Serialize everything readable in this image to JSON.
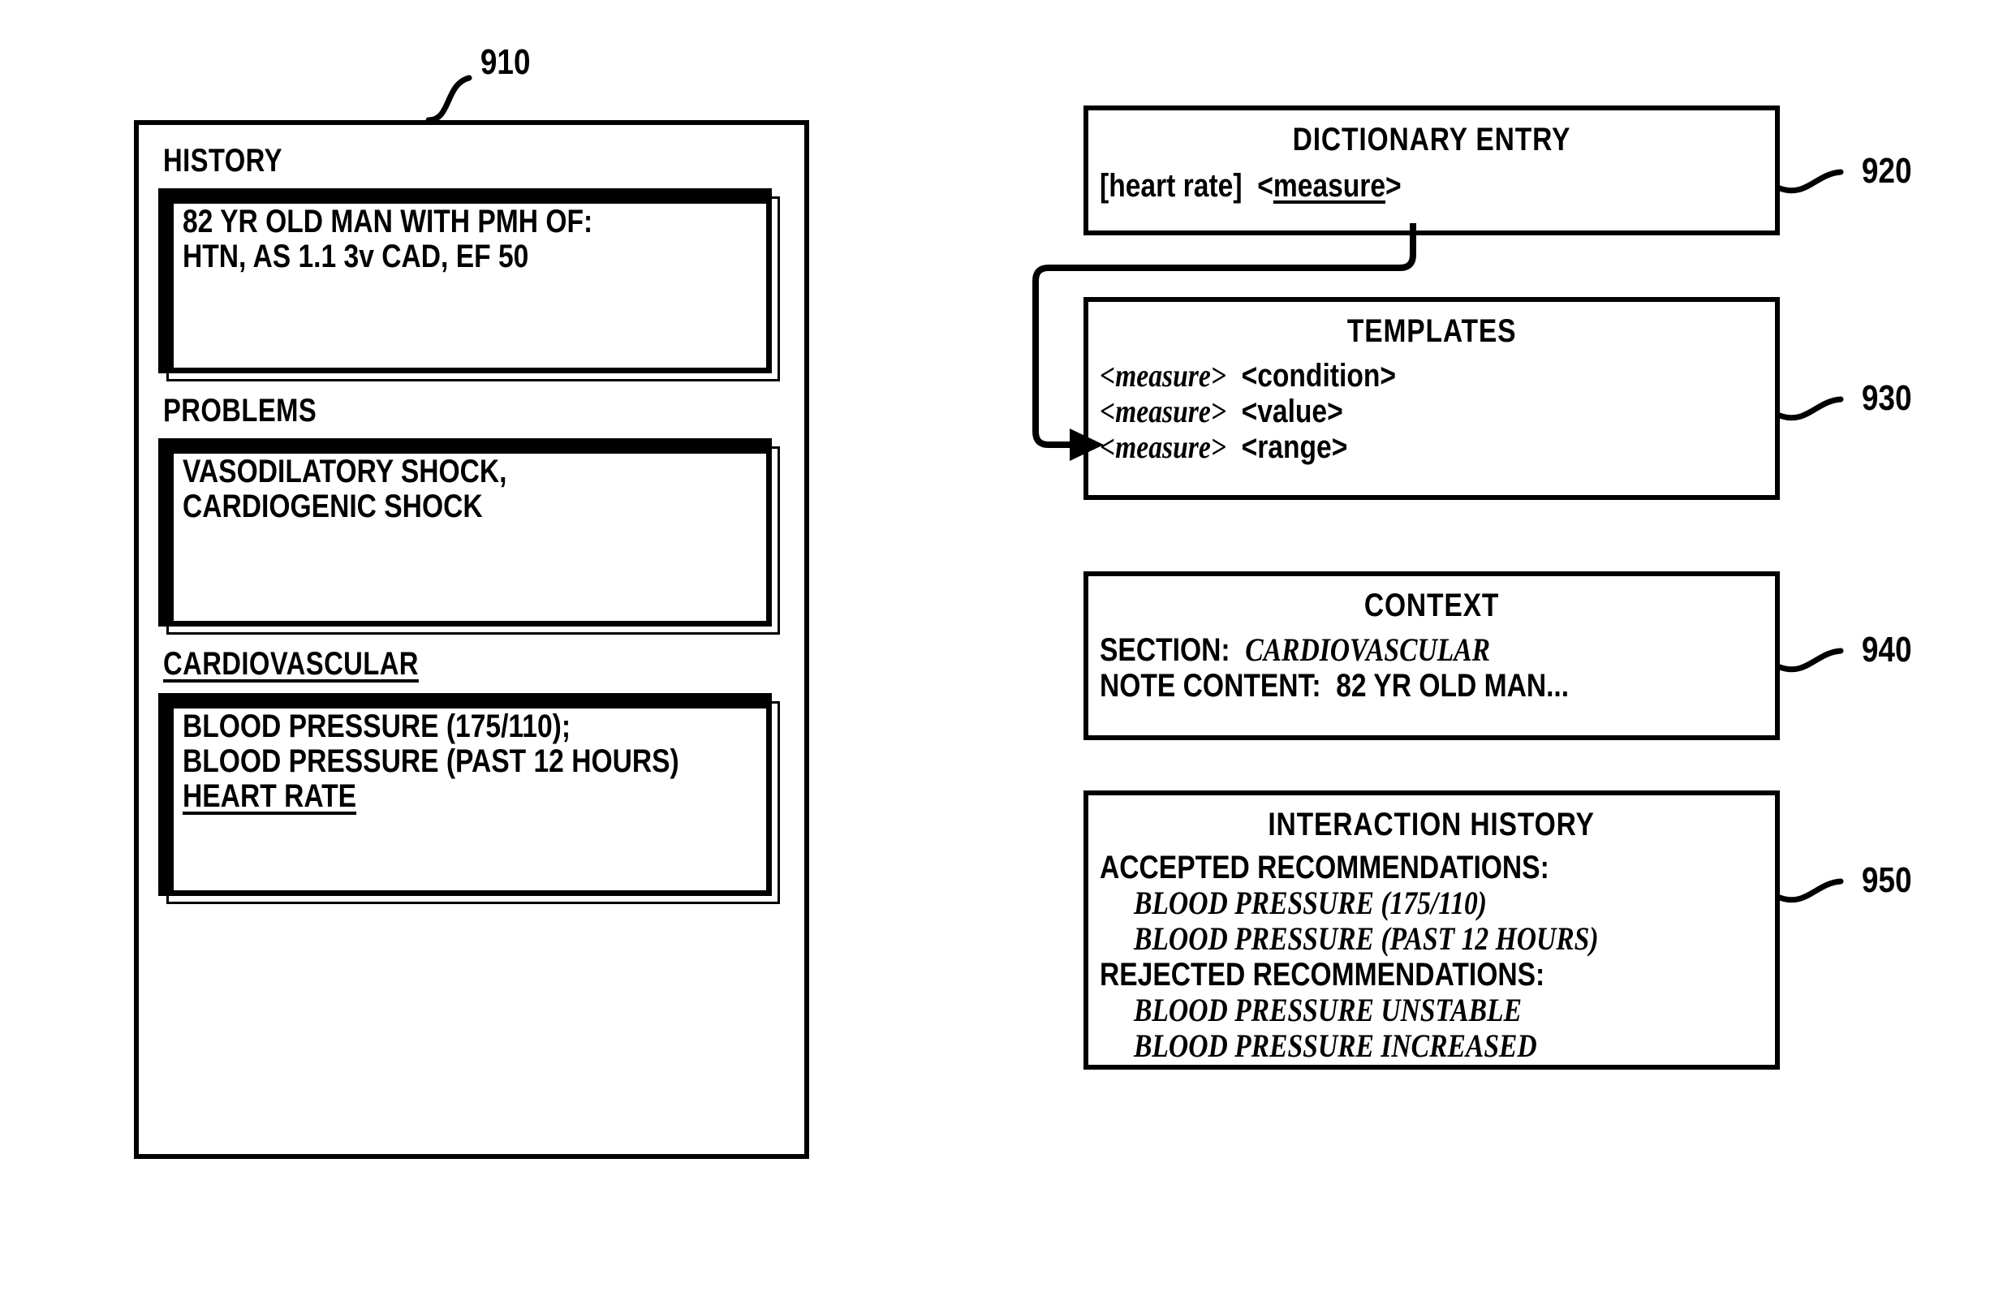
{
  "figure": {
    "ref_910": "910",
    "ref_920": "920",
    "ref_930": "930",
    "ref_940": "940",
    "ref_950": "950"
  },
  "note_panel": {
    "sections": [
      {
        "label": "HISTORY",
        "underlined": false,
        "lines": [
          "82 YR OLD MAN WITH PMH OF:",
          "HTN, AS 1.1 3v CAD, EF 50"
        ]
      },
      {
        "label": "PROBLEMS",
        "underlined": false,
        "lines": [
          "VASODILATORY SHOCK,",
          "CARDIOGENIC SHOCK"
        ]
      },
      {
        "label": "CARDIOVASCULAR",
        "underlined": true,
        "lines": [
          "BLOOD PRESSURE (175/110);",
          "BLOOD PRESSURE (PAST 12 HOURS)",
          "HEART RATE"
        ]
      }
    ]
  },
  "dictionary_entry": {
    "title": "DICTIONARY ENTRY",
    "term": "[heart rate]",
    "tag_open": "<",
    "tag_label": "measure",
    "tag_close": ">"
  },
  "templates": {
    "title": "TEMPLATES",
    "rows": [
      {
        "slot": "<measure>",
        "filler": "<condition>"
      },
      {
        "slot": "<measure>",
        "filler": "<value>"
      },
      {
        "slot": "<measure>",
        "filler": "<range>"
      }
    ]
  },
  "context": {
    "title": "CONTEXT",
    "section_label": "SECTION:",
    "section_value": "CARDIOVASCULAR",
    "note_label": "NOTE CONTENT:",
    "note_value": "82 YR OLD MAN..."
  },
  "interaction_history": {
    "title": "INTERACTION HISTORY",
    "accepted_label": "ACCEPTED RECOMMENDATIONS:",
    "accepted": [
      "BLOOD PRESSURE (175/110)",
      "BLOOD PRESSURE (PAST 12 HOURS)"
    ],
    "rejected_label": "REJECTED RECOMMENDATIONS:",
    "rejected": [
      "BLOOD PRESSURE UNSTABLE",
      "BLOOD PRESSURE INCREASED"
    ]
  }
}
